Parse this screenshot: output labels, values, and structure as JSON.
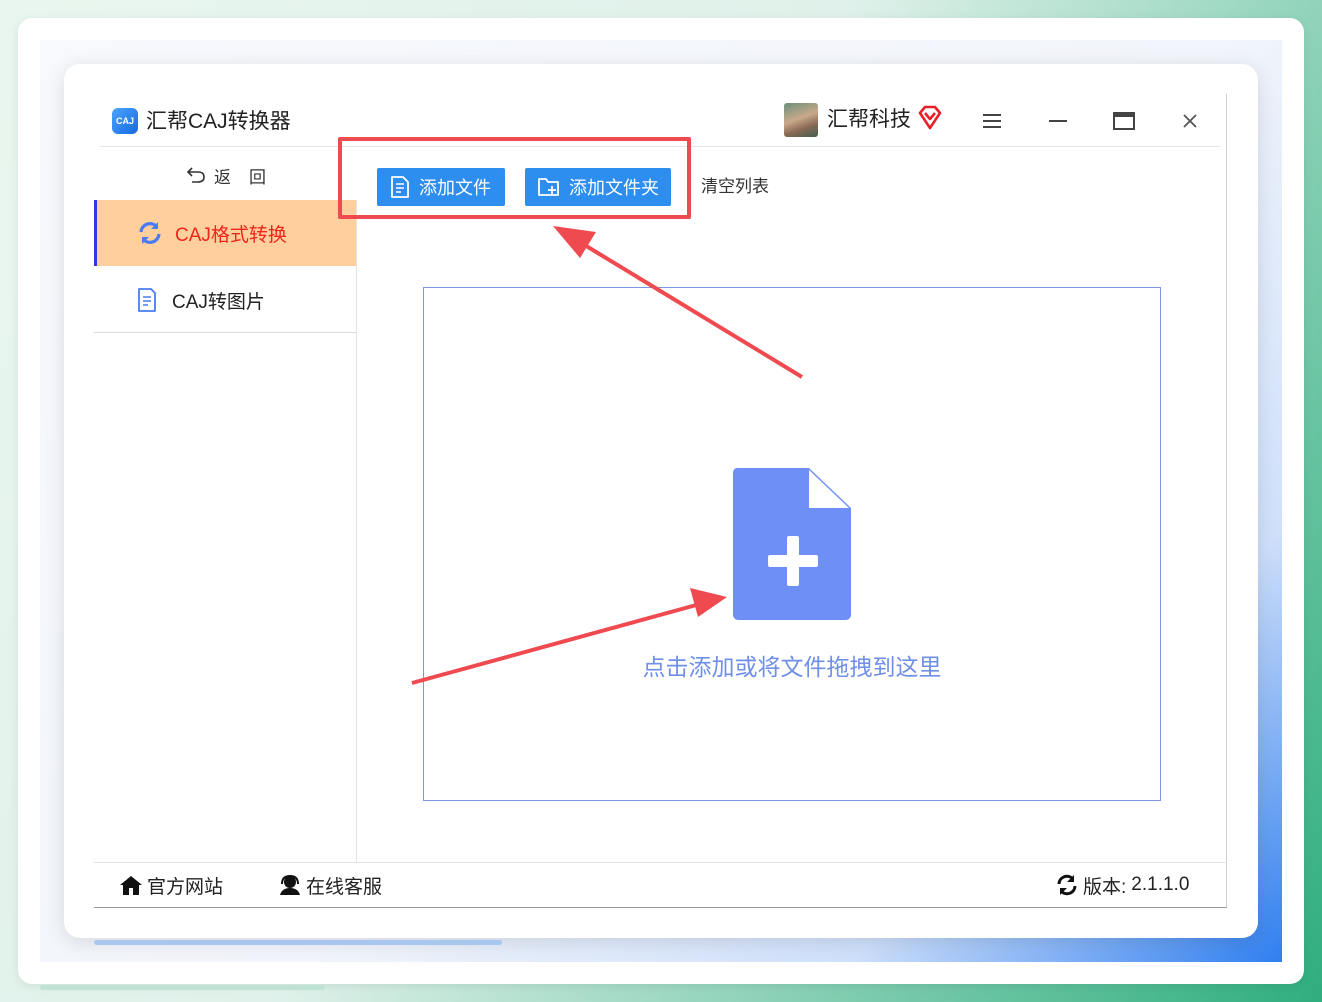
{
  "window": {
    "app_title": "汇帮CAJ转换器",
    "logo_text": "CAJ",
    "user_name": "汇帮科技"
  },
  "titlebar_icons": [
    "vip-diamond-icon",
    "menu-icon",
    "minimize-icon",
    "maximize-icon",
    "close-icon"
  ],
  "sidebar": {
    "back_label": "返回",
    "items": [
      {
        "label": "CAJ格式转换",
        "icon": "refresh-icon",
        "active": true
      },
      {
        "label": "CAJ转图片",
        "icon": "document-icon",
        "active": false
      }
    ]
  },
  "toolbar": {
    "add_file_label": "添加文件",
    "add_folder_label": "添加文件夹",
    "clear_list_label": "清空列表"
  },
  "dropzone": {
    "hint": "点击添加或将文件拖拽到这里"
  },
  "footer": {
    "website_label": "官方网站",
    "support_label": "在线客服",
    "version_label": "版本:",
    "version_value": "2.1.1.0"
  },
  "colors": {
    "primary_button": "#2e8ef0",
    "active_item_bg": "#ffcf9e",
    "active_item_text": "#f0261b",
    "annotation_red": "#ef4a50",
    "drop_accent": "#6f8fe8"
  }
}
